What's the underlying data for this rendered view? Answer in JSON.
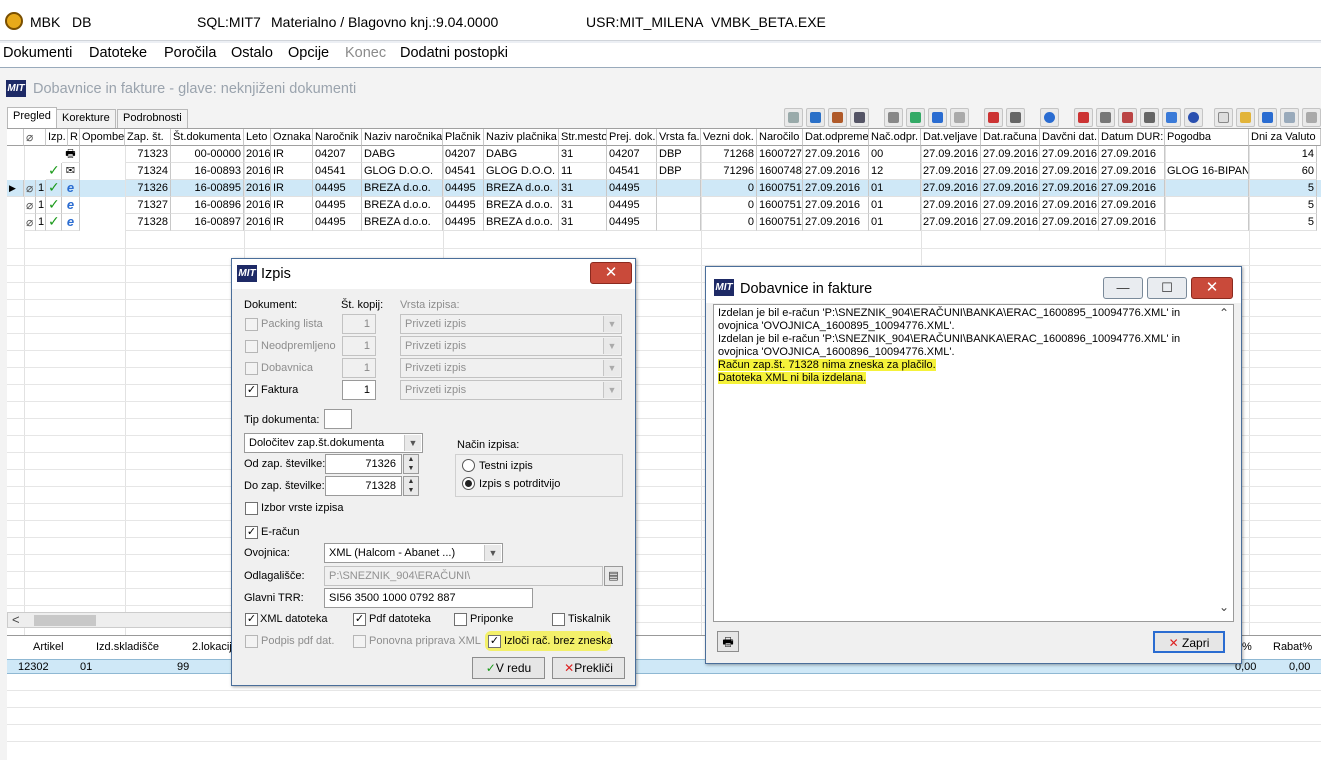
{
  "titlebar": {
    "app": "MBK",
    "db": "DB",
    "sql": "SQL:MIT7",
    "module": "Materialno / Blagovno knj.:9.04.0000",
    "user": "USR:MIT_MILENA",
    "exe": "VMBK_BETA.EXE"
  },
  "menu": [
    "Dokumenti",
    "Datoteke",
    "Poročila",
    "Ostalo",
    "Opcije",
    "Konec",
    "Dodatni postopki"
  ],
  "child": {
    "title": "Dobavnice in fakture - glave: neknjiženi dokumenti",
    "logo": "MIT"
  },
  "tabs": [
    "Pregled",
    "Korekture",
    "Podrobnosti"
  ],
  "grid": {
    "headers": [
      "Izp.",
      "R",
      "Opombe",
      "Zap. št.",
      "Št.dokumenta",
      "Leto",
      "Oznaka",
      "Naročnik",
      "Naziv naročnika",
      "Plačnik",
      "Naziv plačnika",
      "Str.mesto",
      "Prej. dok.",
      "Vrsta fa.",
      "Vezni dok.",
      "Naročilo",
      "Dat.odpreme",
      "Nač.odpr.",
      "Dat.veljave",
      "Dat.računa",
      "Davčni dat.",
      "Datum DUR:",
      "Pogodba",
      "Dni za Valuto"
    ],
    "rows": [
      {
        "izp": "",
        "zap": "71323",
        "dok": "00-00000",
        "leto": "2016",
        "ozn": "IR",
        "nar": "04207",
        "nnar": "DABG",
        "plac": "04207",
        "nplac": "DABG",
        "str": "31",
        "prej": "04207",
        "vrsta": "DBP",
        "vezni": "71268",
        "narocilo": "1600727",
        "odpr": "27.09.2016",
        "nacodpr": "00",
        "velj": "27.09.2016",
        "rac": "27.09.2016",
        "davc": "27.09.2016",
        "dur": "27.09.2016",
        "pog": "",
        "dni": "14"
      },
      {
        "izp": "",
        "zap": "71324",
        "dok": "16-00893",
        "leto": "2016",
        "ozn": "IR",
        "nar": "04541",
        "nnar": "GLOG D.O.O.",
        "plac": "04541",
        "nplac": "GLOG D.O.O.",
        "str": "11",
        "prej": "04541",
        "vrsta": "DBP",
        "vezni": "71296",
        "narocilo": "1600748",
        "odpr": "27.09.2016",
        "nacodpr": "12",
        "velj": "27.09.2016",
        "rac": "27.09.2016",
        "davc": "27.09.2016",
        "dur": "27.09.2016",
        "pog": "GLOG 16-BIPAN",
        "dni": "60"
      },
      {
        "izp": "1",
        "zap": "71326",
        "dok": "16-00895",
        "leto": "2016",
        "ozn": "IR",
        "nar": "04495",
        "nnar": "BREZA d.o.o.",
        "plac": "04495",
        "nplac": "BREZA d.o.o.",
        "str": "31",
        "prej": "04495",
        "vrsta": "",
        "vezni": "0",
        "narocilo": "1600751",
        "odpr": "27.09.2016",
        "nacodpr": "01",
        "velj": "27.09.2016",
        "rac": "27.09.2016",
        "davc": "27.09.2016",
        "dur": "27.09.2016",
        "pog": "",
        "dni": "5"
      },
      {
        "izp": "1",
        "zap": "71327",
        "dok": "16-00896",
        "leto": "2016",
        "ozn": "IR",
        "nar": "04495",
        "nnar": "BREZA d.o.o.",
        "plac": "04495",
        "nplac": "BREZA d.o.o.",
        "str": "31",
        "prej": "04495",
        "vrsta": "",
        "vezni": "0",
        "narocilo": "1600751",
        "odpr": "27.09.2016",
        "nacodpr": "01",
        "velj": "27.09.2016",
        "rac": "27.09.2016",
        "davc": "27.09.2016",
        "dur": "27.09.2016",
        "pog": "",
        "dni": "5"
      },
      {
        "izp": "1",
        "zap": "71328",
        "dok": "16-00897",
        "leto": "2016",
        "ozn": "IR",
        "nar": "04495",
        "nnar": "BREZA d.o.o.",
        "plac": "04495",
        "nplac": "BREZA d.o.o.",
        "str": "31",
        "prej": "04495",
        "vrsta": "",
        "vezni": "0",
        "narocilo": "1600751",
        "odpr": "27.09.2016",
        "nacodpr": "01",
        "velj": "27.09.2016",
        "rac": "27.09.2016",
        "davc": "27.09.2016",
        "dur": "27.09.2016",
        "pog": "",
        "dni": "5"
      }
    ]
  },
  "detail": {
    "headers": [
      "Artikel",
      "Izd.skladišče",
      "2.lokacij",
      "t%",
      "Rabat%"
    ],
    "row": {
      "artikel": "12302",
      "skladisce": "01",
      "lokacija": "99",
      "t": "0,00",
      "rabat": "0,00"
    }
  },
  "izpis": {
    "title": "Izpis",
    "dokument_label": "Dokument:",
    "kopij_label": "Št. kopij:",
    "vrsta_label": "Vrsta izpisa:",
    "docs": [
      {
        "label": "Packing lista",
        "copies": "1",
        "vrsta": "Privzeti izpis",
        "checked": false,
        "enabled": false
      },
      {
        "label": "Neodpremljeno",
        "copies": "1",
        "vrsta": "Privzeti izpis",
        "checked": false,
        "enabled": false
      },
      {
        "label": "Dobavnica",
        "copies": "1",
        "vrsta": "Privzeti izpis",
        "checked": false,
        "enabled": false
      },
      {
        "label": "Faktura",
        "copies": "1",
        "vrsta": "Privzeti izpis",
        "checked": true,
        "enabled": true
      }
    ],
    "tip_label": "Tip dokumenta:",
    "dolocitev": "Določitev zap.št.dokumenta",
    "od_label": "Od zap. številke:",
    "od_value": "71326",
    "do_label": "Do zap. številke:",
    "do_value": "71328",
    "nacin_label": "Način izpisa:",
    "testni": "Testni izpis",
    "potrditev": "Izpis s potrditvijo",
    "izbor": "Izbor vrste izpisa",
    "eracun": "E-račun",
    "ovojnica_label": "Ovojnica:",
    "ovojnica_value": "XML (Halcom - Abanet ...)",
    "odlag_label": "Odlagališče:",
    "odlag_value": "P:\\SNEZNIK_904\\ERAČUNI\\",
    "trr_label": "Glavni TRR:",
    "trr_value": "SI56 3500 1000 0792 887",
    "xml": "XML datoteka",
    "pdf": "Pdf datoteka",
    "priponke": "Priponke",
    "tiskalnik": "Tiskalnik",
    "podpis": "Podpis pdf dat.",
    "ponovna": "Ponovna priprava XML",
    "izloci": "Izloči rač. brez zneska",
    "ok": "V redu",
    "cancel": "Prekliči"
  },
  "msg": {
    "title": "Dobavnice in fakture",
    "lines": [
      "Izdelan je bil e-račun 'P:\\SNEZNIK_904\\ERAČUNI\\BANKA\\ERAC_1600895_10094776.XML' in",
      "ovojnica 'OVOJNICA_1600895_10094776.XML'.",
      "Izdelan je bil e-račun 'P:\\SNEZNIK_904\\ERAČUNI\\BANKA\\ERAC_1600896_10094776.XML' in",
      "ovojnica 'OVOJNICA_1600896_10094776.XML'."
    ],
    "highlight": [
      "Račun zap.št. 71328 nima zneska za plačilo.",
      "Datoteka XML ni bila izdelana."
    ],
    "close": "Zapri"
  }
}
